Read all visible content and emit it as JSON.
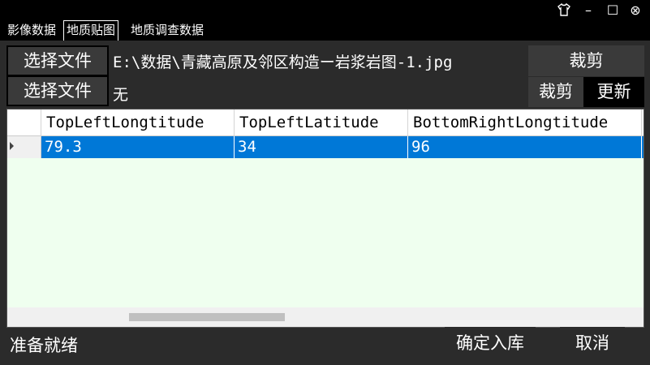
{
  "window": {
    "controls": {
      "skin_icon": "shirt-icon",
      "minimize": "–",
      "maximize": "☐",
      "close": "⊗"
    }
  },
  "tabs": [
    {
      "label": "影像数据",
      "active": false
    },
    {
      "label": "地质贴图",
      "active": true
    },
    {
      "label": "地质调查数据",
      "active": false
    }
  ],
  "files": {
    "select_label_1": "选择文件",
    "path_1": "E:\\数据\\青藏高原及邻区构造ー岩浆岩图-1.jpg",
    "select_label_2": "选择文件",
    "path_2": "无"
  },
  "actions": {
    "crop_top": "裁剪",
    "crop": "裁剪",
    "update": "更新"
  },
  "table": {
    "columns": [
      "TopLeftLongtitude",
      "TopLeftLatitude",
      "BottomRightLongtitude"
    ],
    "rows": [
      [
        "79.3",
        "34",
        "96"
      ]
    ]
  },
  "footer": {
    "status": "准备就绪",
    "confirm": "确定入库",
    "cancel": "取消"
  },
  "colors": {
    "selection": "#0078d7",
    "grid_background": "#efffef",
    "panel": "#2b2b2b"
  }
}
